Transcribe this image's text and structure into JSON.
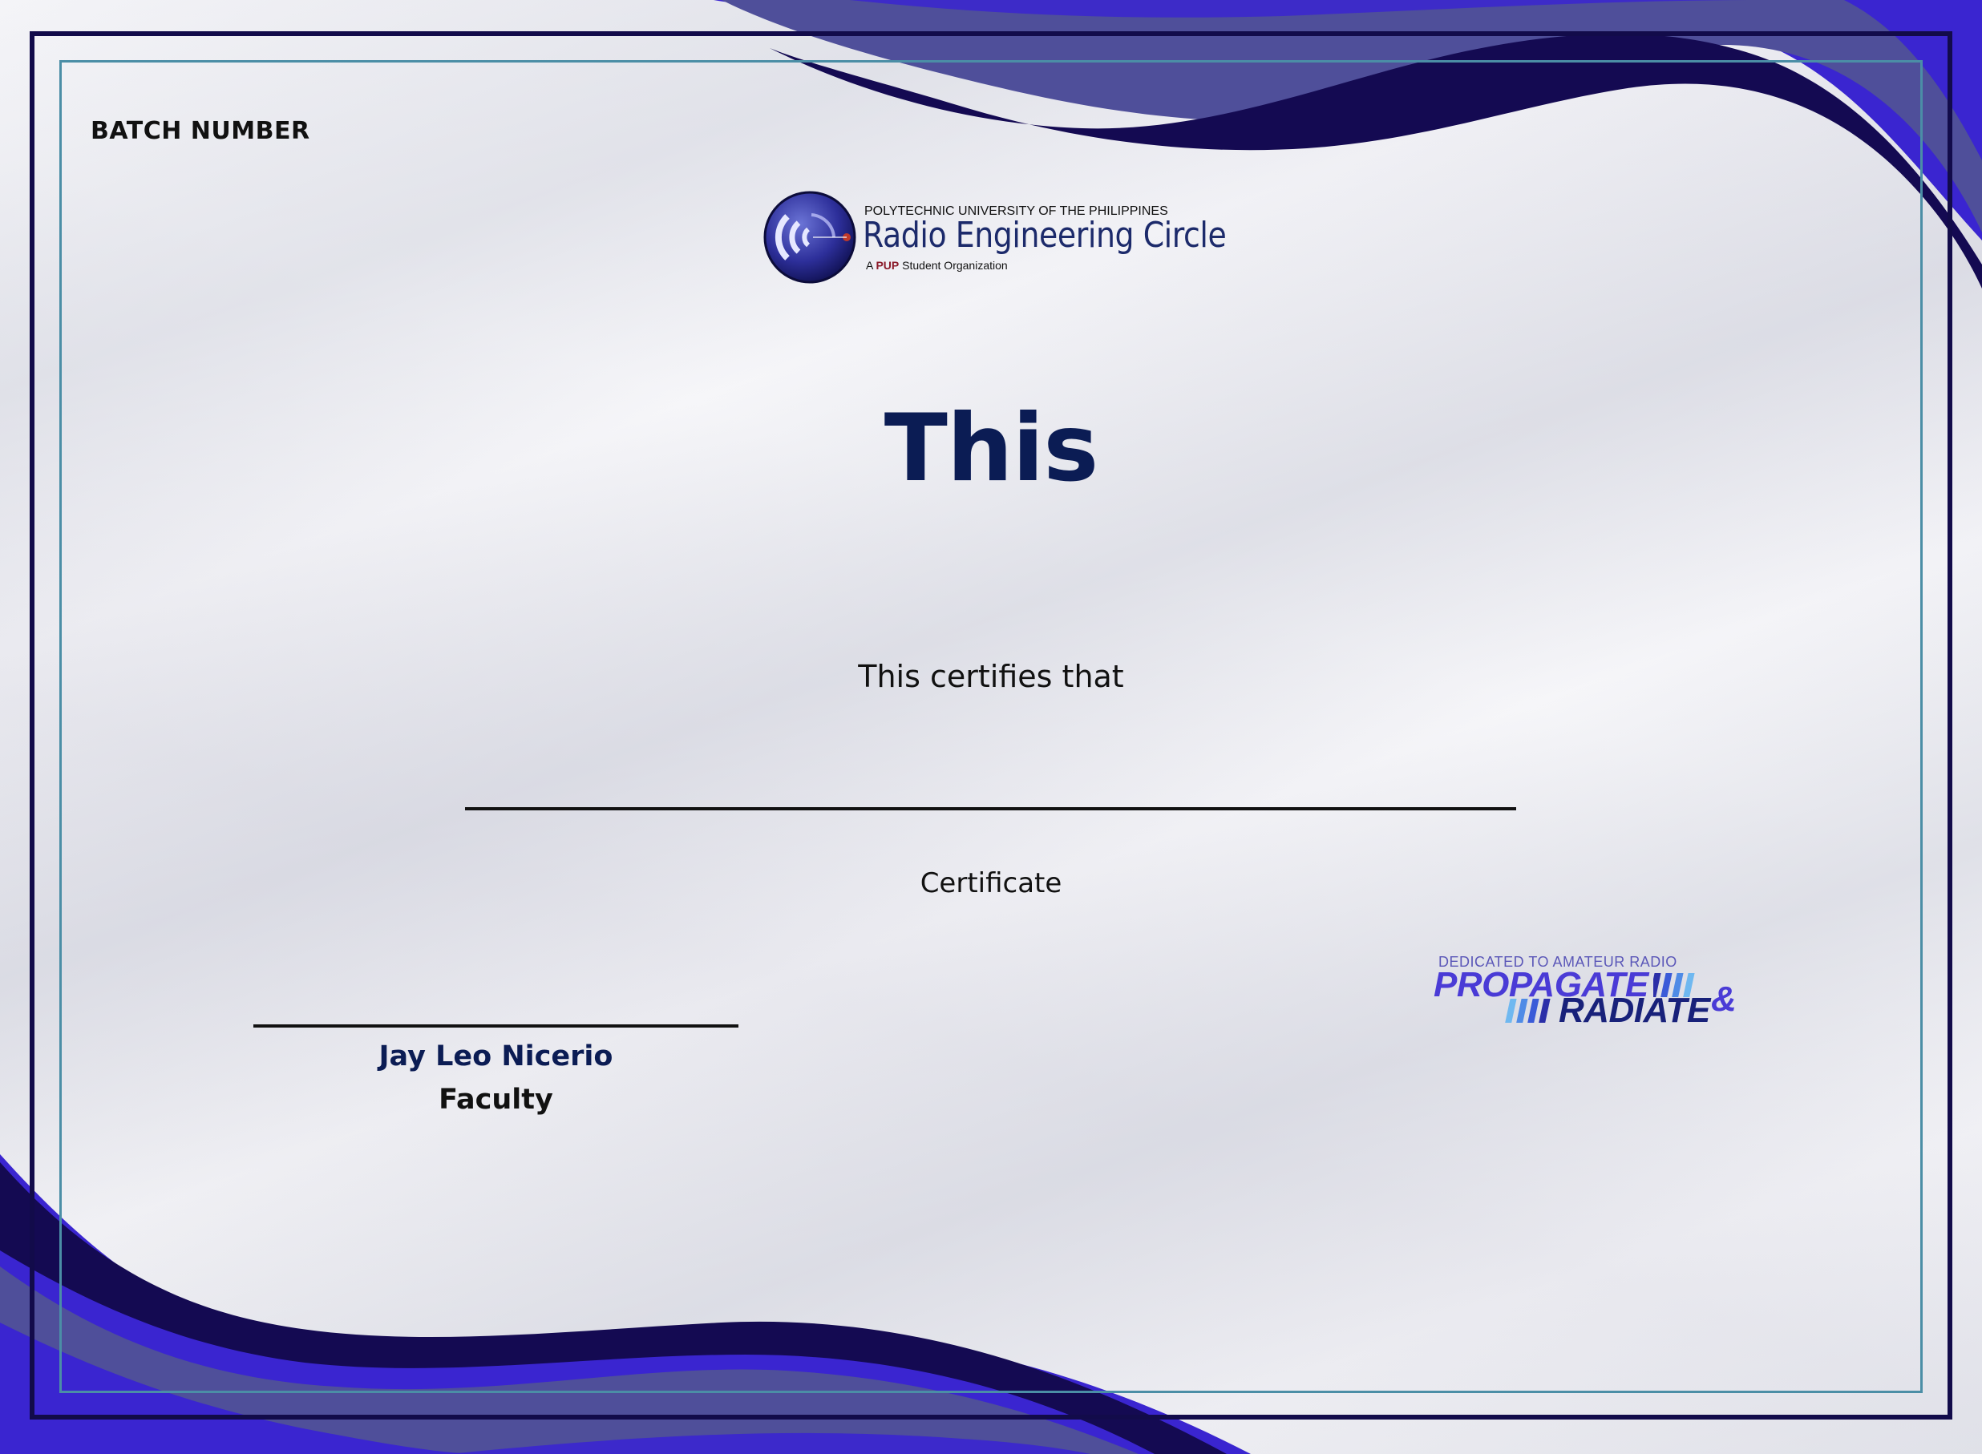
{
  "batch_label": "BATCH NUMBER",
  "logo": {
    "university": "POLYTECHNIC UNIVERSITY OF THE PHILIPPINES",
    "organization": "Radio Engineering Circle",
    "tagline_prefix": "A",
    "tagline_abbr": "PUP",
    "tagline_suffix": "Student Organization"
  },
  "title": "This",
  "certifies": "This certifies that",
  "certificate_label": "Certificate",
  "signatory": {
    "name": "Jay Leo Nicerio",
    "role": "Faculty"
  },
  "event_logo": {
    "dedication": "DEDICATED TO AMATEUR RADIO",
    "word1": "PROPAGATE",
    "word2": "RADIATE",
    "ampersand": "&"
  },
  "colors": {
    "navy": "#0b1c54",
    "frame": "#120b4a",
    "inner_border": "#4b8ea6",
    "wave_dark": "#140a52",
    "wave_mid": "#4f4f9a",
    "wave_bright": "#3a25d0"
  }
}
